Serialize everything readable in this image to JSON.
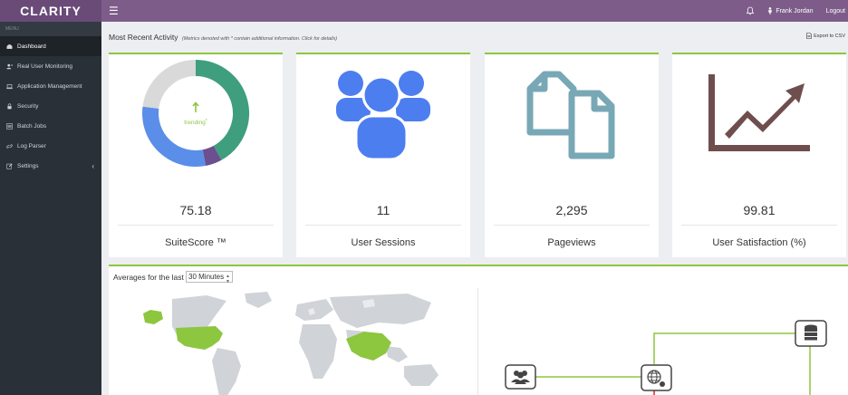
{
  "brand": {
    "name": "CLARITY"
  },
  "topbar": {
    "user_name": "Frank Jordan",
    "logout_label": "Logout"
  },
  "sidebar": {
    "menu_title": "MENU",
    "items": [
      {
        "label": "Dashboard",
        "icon": "dashboard-icon",
        "active": true
      },
      {
        "label": "Real User Monitoring",
        "icon": "user-plus-icon"
      },
      {
        "label": "Application Management",
        "icon": "laptop-icon"
      },
      {
        "label": "Security",
        "icon": "lock-icon"
      },
      {
        "label": "Batch Jobs",
        "icon": "list-icon"
      },
      {
        "label": "Log Parser",
        "icon": "link-icon"
      },
      {
        "label": "Settings",
        "icon": "edit-icon",
        "chevron": "‹"
      }
    ]
  },
  "main": {
    "title": "Most Recent Activity",
    "note": "(Metrics denoted with * contain additional information. Click for details)",
    "export_label": "Export to CSV"
  },
  "cards": [
    {
      "value": "75.18",
      "label": "SuiteScore ™",
      "trending_text": "trending",
      "trending_marker": "*"
    },
    {
      "value": "11",
      "label": "User Sessions"
    },
    {
      "value": "2,295",
      "label": "Pageviews"
    },
    {
      "value": "99.81",
      "label": "User Satisfaction (%)"
    }
  ],
  "donut": {
    "segments": [
      {
        "name": "green",
        "value": 42,
        "color": "#3e9e7e"
      },
      {
        "name": "purple",
        "value": 5,
        "color": "#6b4f8e"
      },
      {
        "name": "blue",
        "value": 30,
        "color": "#5a8ee8"
      },
      {
        "name": "gray",
        "value": 23,
        "color": "#d9d9d9"
      }
    ],
    "trend_color": "#8dc63f"
  },
  "bottom": {
    "averages_label": "Averages for the last",
    "selected_range": "30 Minutes"
  },
  "colors": {
    "accent": "#8dc63f",
    "header": "#7d5c8a",
    "sessions_icon": "#4d7ef0",
    "pageviews_icon": "#78a8b6",
    "satisfaction_icon": "#6f4e4e"
  }
}
